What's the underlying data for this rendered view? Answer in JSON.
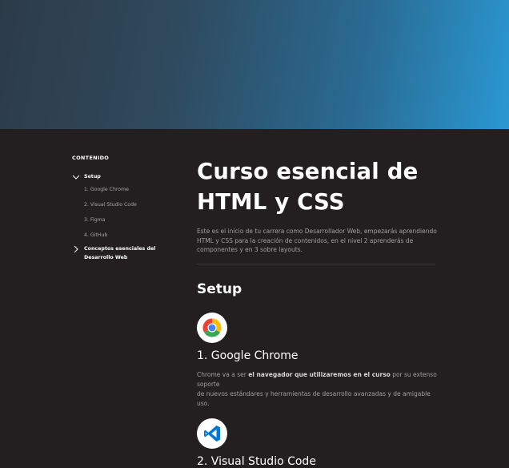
{
  "sidebar": {
    "heading": "CONTENIDO",
    "sections": [
      {
        "label": "Setup",
        "expanded": true,
        "items": [
          "1. Google Chrome",
          "2. Visual Studio Code",
          "3. Figma",
          "4. GitHub"
        ]
      },
      {
        "label_line1": "Conceptos esenciales del",
        "label_line2": "Desarrollo Web",
        "expanded": false
      }
    ]
  },
  "main": {
    "title_line1": "Curso esencial de",
    "title_line2": "HTML y CSS",
    "intro_line1": "Este es el inicio de tu carrera como Desarrollador Web, empezarás aprendiendo",
    "intro_line2": "HTML y CSS para la creación de contenidos, en el nivel 2 aprenderás de",
    "intro_line3": "componentes y en 3 sobre layouts.",
    "section_title": "Setup",
    "tools": [
      {
        "icon": "chrome-icon",
        "title": "1. Google Chrome",
        "desc_before": "Chrome va a ser ",
        "desc_bold": "el navegador que utilizaremos en el curso",
        "desc_after": " por su extenso soporte",
        "desc_line2": "de nuevos estándares y herramientas de desarrollo avanzadas y de amigable uso."
      },
      {
        "icon": "vscode-icon",
        "title": "2. Visual Studio Code"
      }
    ]
  },
  "colors": {
    "background": "#231f21",
    "hero_gradient_start": "#2d3b48",
    "hero_gradient_end": "#2a98d2",
    "muted_text": "#a39fa1",
    "vscode_blue": "#0078d4"
  }
}
